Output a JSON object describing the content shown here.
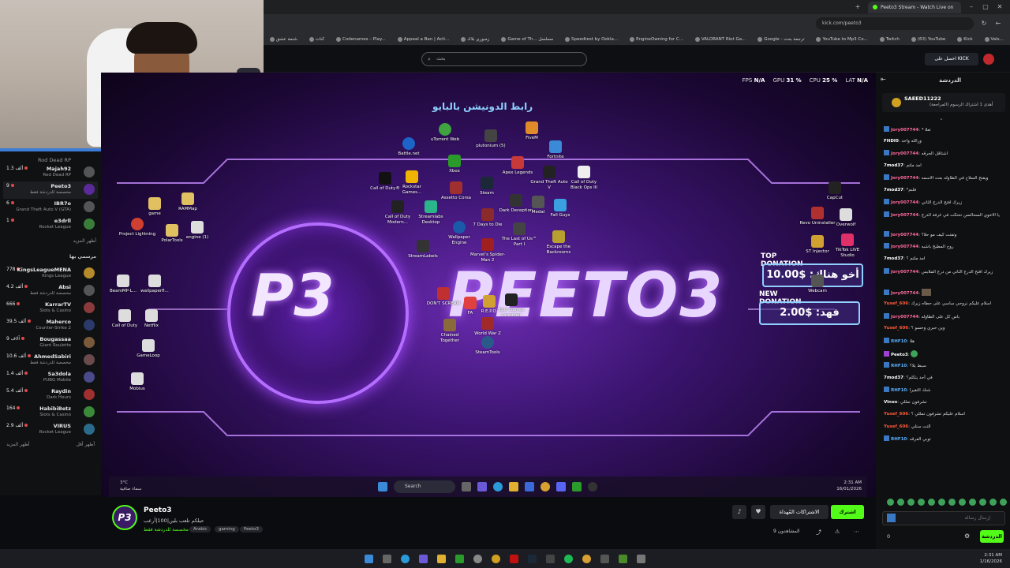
{
  "browser": {
    "active_tab": "Peeto3 Stream - Watch Live on",
    "url": "kick.com/peeto3",
    "bookmarks": [
      "شتمة عشق",
      "كنات",
      "Codenames – Play...",
      "Appeal a Ban | Acti...",
      "زمبوري بلاك",
      "Game of Th... مسلسل",
      "Speedtest by Ookla...",
      "EngineOwning for C...",
      "VALORANT Riot Ga...",
      "Google - ترجمة بحث",
      "YouTube to Mp3 Co...",
      "Twitch",
      "(63) YouTube",
      "Kick",
      "Vals..."
    ]
  },
  "header": {
    "search_placeholder": "بحث",
    "get_kick": "احصل على KICK",
    "colors": {
      "accent": "#53fc18"
    }
  },
  "sidebar": {
    "items": [
      {
        "name": "Rod Dead RP",
        "game": "Red Dead RP",
        "viewers": ""
      },
      {
        "name": "Majah92",
        "game": "Red Dead RP",
        "viewers": "1.3 ألف"
      },
      {
        "name": "Peeto3",
        "game": "مخصصة للدردشة فقط",
        "viewers": "9"
      },
      {
        "name": "IBR7o",
        "game": "Grand Theft Auto V (GTA)",
        "viewers": "6"
      },
      {
        "name": "e3drll",
        "game": "Rocket League",
        "viewers": "1"
      }
    ],
    "show_more": "أظهر المزيد",
    "recommended_header": "مرسمي بها",
    "recommended": [
      {
        "name": "KingsLeagueMENA",
        "game": "Kings League",
        "viewers": "778"
      },
      {
        "name": "Absi",
        "game": "مخصصة للدردشة فقط",
        "viewers": "4.2 ألف"
      },
      {
        "name": "KarrarTV",
        "game": "Slots & Casino",
        "viewers": "666"
      },
      {
        "name": "Maherco",
        "game": "Counter-Strike 2",
        "viewers": "39.5 ألف"
      },
      {
        "name": "Bougassaa",
        "game": "Giant Roulette",
        "viewers": "9 آلاف"
      },
      {
        "name": "AhmedSabiri",
        "game": "مخصصة للدردشة فقط",
        "viewers": "10.6 ألف"
      },
      {
        "name": "Sa3dola",
        "game": "PUBG Mobile",
        "viewers": "1.4 ألف"
      },
      {
        "name": "Raydin",
        "game": "Dark Hours",
        "viewers": "5.4 ألف"
      },
      {
        "name": "HabibiBetz",
        "game": "Slots & Casino",
        "viewers": "164"
      },
      {
        "name": "VIRUS",
        "game": "Rocket League",
        "viewers": "2.9 ألف"
      }
    ],
    "show_more_2": "أظهر المزيد",
    "show_less": "أظهر أقل"
  },
  "player": {
    "hud": {
      "fps_label": "FPS",
      "fps": "N/A",
      "gpu_label": "GPU",
      "gpu": "31 %",
      "cpu_label": "CPU",
      "cpu": "25 %",
      "lat_label": "LAT",
      "lat": "N/A"
    },
    "donate_title": "رابط الدونيشن بالبايو",
    "logo": "P3",
    "streamer_big": "PEETO3",
    "top_donation_label": "TOP DONATION",
    "top_donation_value": "10.00$ :أخو هناك",
    "new_donation_label": "NEW DONATION",
    "new_donation_value": "2.00$ :فهد",
    "desktop_icons": [
      "uTorrent Web",
      "plutonium (5)",
      "FiveM",
      "Battle.net",
      "Fortnite",
      "Xbox",
      "Apex Legends",
      "Grand Theft Auto V",
      "Call of Duty Black Ops III",
      "Call of Duty®",
      "Rockstar Games...",
      "Assetto Corsa",
      "Steam",
      "Dark Deception",
      "Medal",
      "Fall Guys",
      "Call of Duty Modern...",
      "Streamlabs Desktop",
      "7 Days to Die",
      "Wallpaper Engine",
      "The Last of Us™ Part I",
      "Escape the Backrooms",
      "StreamLabels",
      "Marvel's Spider-Man 2",
      "Chained Together",
      "World War Z",
      "SteamTools",
      "R.E.P.O.",
      "DON'T SCREAM",
      "FA",
      "Epic Games Launcher",
      "CapCut",
      "Revo Uninstaller",
      "Overwolf",
      "ST Injector",
      "TikTok LIVE Studio",
      "Webcam",
      "Project Lightning",
      "PolarTools",
      "engine (1)",
      "game",
      "RAMMap",
      "BeamMP-L...",
      "wallpaperfl...",
      "Call of Duty",
      "Netflix",
      "GameLoop",
      "Mobius"
    ],
    "taskbar_search": "Search",
    "taskbar_time": "2:31 AM",
    "taskbar_date": "16/01/2026",
    "weather_temp": "3°C",
    "weather_desc": "سماء صافية"
  },
  "chat": {
    "title": "الدردشة",
    "pinned_user": "SAEED11222",
    "pinned_text": "أهدى 1 اشتراك الرسوم (المراجعة)",
    "messages": [
      {
        "user": "Jory007744",
        "text": "* تعلا"
      },
      {
        "user": "FHDI0",
        "text": "ورالله واحد"
      },
      {
        "user": "Jory007744",
        "text": "اشتاقل الحرقه"
      },
      {
        "user": "7mod37",
        "text": "امد ملتم"
      },
      {
        "user": "Jory007744",
        "text": "ويفتح السلاح في الطاوله بعث الاسمه"
      },
      {
        "user": "7mod37",
        "text": "*فلنم"
      },
      {
        "user": "Jory007744",
        "text": "زيرك افتح الدرج الثاني"
      },
      {
        "user": "Jory007744",
        "text": "يا الاخوي السحالسن تحتكت في غرفة الدرج"
      },
      {
        "user": "Jory007744",
        "text": "وتفتت كيف مو حلا؟"
      },
      {
        "user": "Jory007744",
        "text": "روح المطبخ باشبه"
      },
      {
        "user": "7mod37",
        "text": "امد ملتم ؟"
      },
      {
        "user": "Jory007744",
        "text": "زيرك افتح الدرج الثاني من درج الملابس"
      },
      {
        "user": "Jory007744",
        "text": ""
      },
      {
        "user": "Yusef_606",
        "text": "اسلام عليكم نروحي ساسي على حطاه زيرك"
      },
      {
        "user": "Jory007744",
        "text": "باس كل على الطاوله"
      },
      {
        "user": "Yusef_606",
        "text": "وين حبري وحسو ؟"
      },
      {
        "user": "RHF10",
        "text": "هلا"
      },
      {
        "user": "Peeto3",
        "text": ""
      },
      {
        "user": "RHF10",
        "text": "سبط يلا؟"
      },
      {
        "user": "7mod37",
        "text": "في أحد يتكلم؟"
      },
      {
        "user": "RHF10",
        "text": "شنك الثقيرا"
      },
      {
        "user": "Vinox",
        "text": "تشرفون تمللي"
      },
      {
        "user": "Yusef_606",
        "text": "اسلام عليكم تشرفون تمللي ؟"
      },
      {
        "user": "Yusef_606",
        "text": "التت ستلي"
      },
      {
        "user": "RHF10",
        "text": "توبي الفرقه"
      }
    ],
    "input_placeholder": "إرسال رسالة",
    "send": "الدردشة",
    "points": "0"
  },
  "stream_info": {
    "channel": "Peeto3",
    "title": "حيلكم تلعب بلين|100|أرعب",
    "category": "مخصصة للدردشة فقط",
    "tags": [
      "Arabic",
      "gaming",
      "Peeto3"
    ],
    "follow": "اشترك",
    "subscribe": "الاشتراكات المُهداة",
    "viewers": "المشاهدون 9"
  },
  "os": {
    "time": "2:31 AM",
    "date": "1/16/2026"
  }
}
